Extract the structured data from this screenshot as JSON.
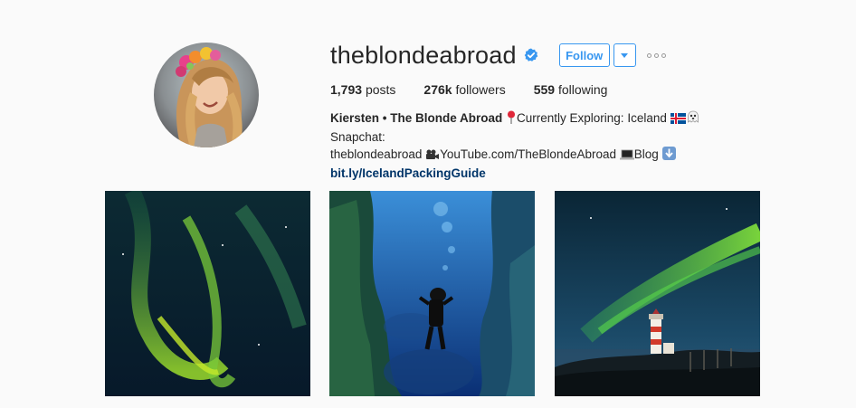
{
  "profile": {
    "username": "theblondeabroad",
    "verified": true,
    "follow_label": "Follow",
    "accent_color": "#3897f0",
    "link_color": "#003569"
  },
  "stats": {
    "posts_count": "1,793",
    "posts_label": "posts",
    "followers_count": "276k",
    "followers_label": "followers",
    "following_count": "559",
    "following_label": "following"
  },
  "bio": {
    "name": "Kiersten • The Blonde Abroad",
    "line1_text1": "Currently Exploring: Iceland",
    "line1_text2": "Snapchat:",
    "line2_text1": "theblondeabroad",
    "line2_text2": "YouTube.com/TheBlondeAbroad",
    "line2_text3": "Blog",
    "link": "bit.ly/IcelandPackingGuide",
    "emojis": [
      "pin-icon",
      "iceland-flag-icon",
      "ghost-icon",
      "video-camera-icon",
      "laptop-icon",
      "down-arrow-icon"
    ]
  },
  "posts": [
    {
      "subject": "aurora-green"
    },
    {
      "subject": "underwater-diver"
    },
    {
      "subject": "lighthouse-aurora"
    }
  ]
}
